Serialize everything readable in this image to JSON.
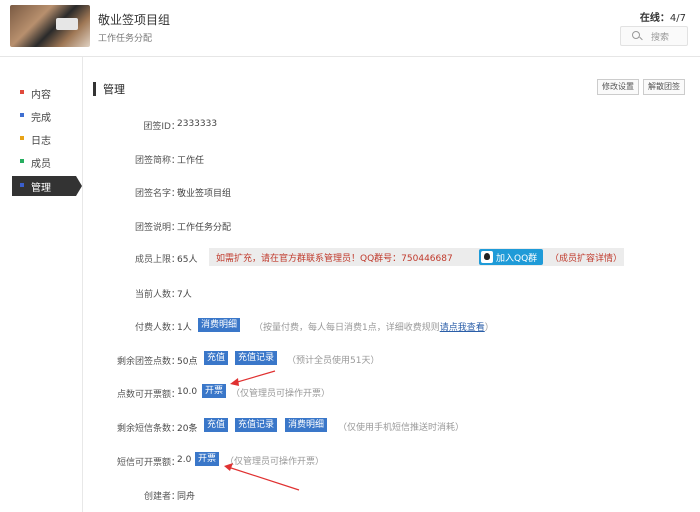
{
  "header": {
    "group_name": "敬业签项目组",
    "group_desc": "工作任务分配",
    "online_label": "在线：",
    "online_value": "4/7",
    "search_placeholder": "搜索"
  },
  "sidebar": {
    "items": [
      {
        "label": "内容",
        "color": "#e04a3c"
      },
      {
        "label": "完成",
        "color": "#3f6fd1"
      },
      {
        "label": "日志",
        "color": "#e8a317"
      },
      {
        "label": "成员",
        "color": "#27ae60"
      },
      {
        "label": "管理",
        "color": "#3a5fcd"
      }
    ]
  },
  "main": {
    "title": "管理",
    "edit_button": "修改设置",
    "dissolve_button": "解散团签",
    "rows": [
      {
        "label": "团签ID：",
        "value": "2333333"
      },
      {
        "label": "团签简称：",
        "value": "工作任"
      },
      {
        "label": "团签名字：",
        "value": "敬业签项目组"
      },
      {
        "label": "团签说明：",
        "value": "工作任务分配"
      },
      {
        "label": "成员上限：",
        "value": "65人"
      },
      {
        "label": "当前人数：",
        "value": "7人"
      },
      {
        "label": "付费人数：",
        "value": "1人"
      },
      {
        "label": "剩余团签点数：",
        "value": "50点"
      },
      {
        "label": "点数可开票额：",
        "value": "10.0"
      },
      {
        "label": "剩余短信条数：",
        "value": "20条"
      },
      {
        "label": "短信可开票额：",
        "value": "2.0"
      },
      {
        "label": "创建者：",
        "value": "同舟"
      }
    ],
    "notice": {
      "message": "如需扩充，请在官方群联系管理员！QQ群号：750446687",
      "qq_button": "加入QQ群",
      "more": "（成员扩容详情）"
    },
    "paid": {
      "tag": "消费明细",
      "hint_prefix": "（按量付费，每人每日消费1点，详细收费规则",
      "hint_link": "请点我查看",
      "hint_suffix": "）"
    },
    "points": {
      "recharge": "充值",
      "record": "充值记录",
      "hint": "（预计全员使用51天）"
    },
    "points_invoice": {
      "tag": "开票",
      "hint": "（仅管理员可操作开票）"
    },
    "sms": {
      "recharge": "充值",
      "record": "充值记录",
      "detail": "消费明细",
      "hint": "（仅使用手机短信推送时消耗）"
    },
    "sms_invoice": {
      "tag": "开票",
      "hint": "（仅管理员可操作开票）"
    }
  },
  "colors": {
    "accent": "#3a77c9",
    "arrow": "#e03131",
    "notice_text": "#c0392b",
    "qq_button": "#1f9bd8"
  }
}
